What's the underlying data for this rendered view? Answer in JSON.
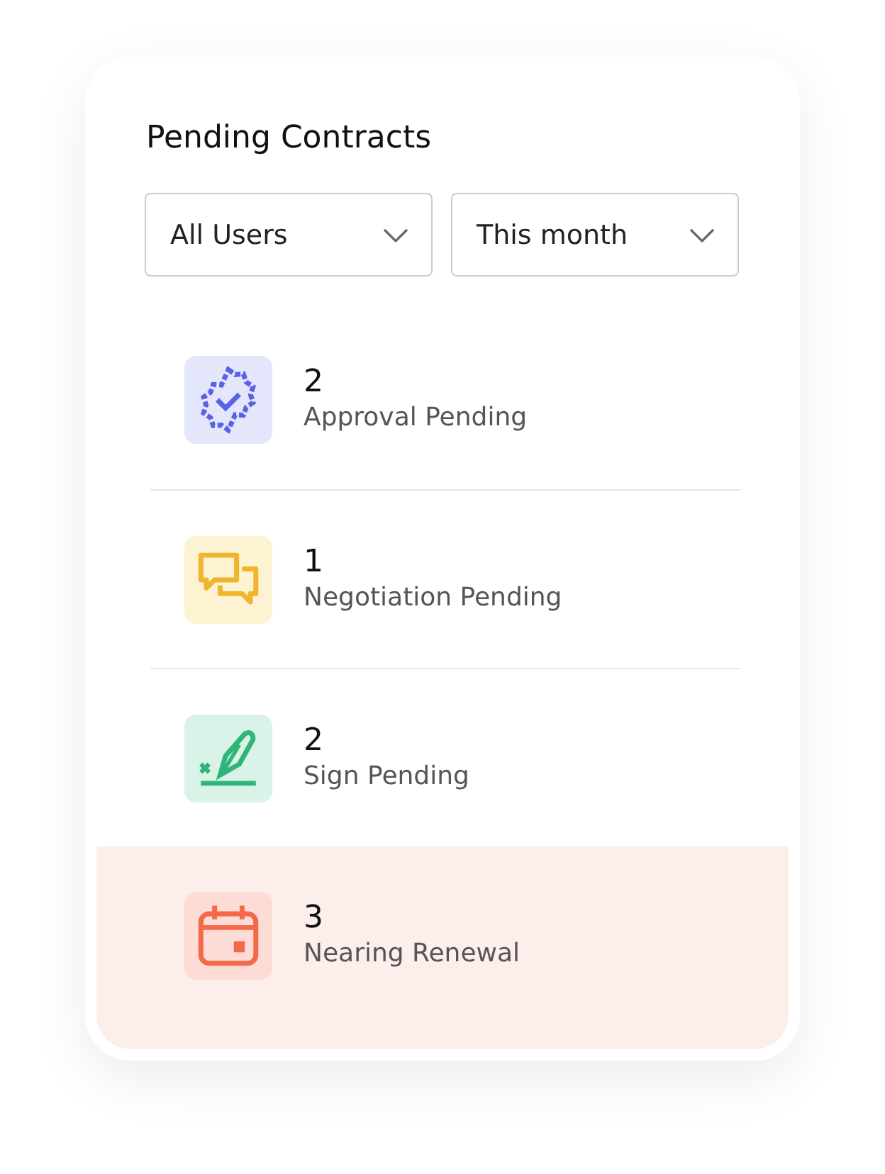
{
  "title": "Pending Contracts",
  "filters": [
    {
      "value": "All Users"
    },
    {
      "value": "This month"
    }
  ],
  "items": [
    {
      "kind": "approval",
      "count": "2",
      "label": "Approval Pending",
      "selected": false
    },
    {
      "kind": "negotiation",
      "count": "1",
      "label": "Negotiation Pending",
      "selected": false
    },
    {
      "kind": "sign",
      "count": "2",
      "label": "Sign Pending",
      "selected": false
    },
    {
      "kind": "renewal",
      "count": "3",
      "label": "Nearing Renewal",
      "selected": true
    }
  ]
}
